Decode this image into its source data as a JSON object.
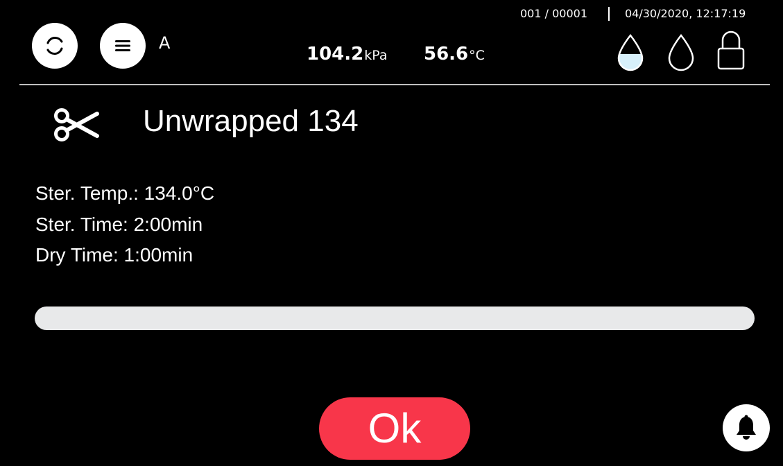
{
  "header": {
    "refresh_icon": "refresh-icon",
    "menu_icon": "menu-icon",
    "profile_letter": "A",
    "counter": "001 / 00001",
    "datetime": "04/30/2020, 12:17:19",
    "pressure": {
      "value": "104.2",
      "unit": "kPa"
    },
    "temperature": {
      "value": "56.6",
      "unit": "°C"
    },
    "status_icons": [
      "water-drop-filled-icon",
      "water-drop-empty-icon",
      "lock-open-icon"
    ],
    "water_fill_color": "#d7f0fa"
  },
  "program": {
    "icon": "scissors-icon",
    "name": "Unwrapped 134",
    "params": [
      "Ster. Temp.: 134.0°C",
      "Ster. Time: 2:00min",
      "Dry Time: 1:00min"
    ]
  },
  "progress": {
    "percent": 0,
    "track_color": "#e8e9ea"
  },
  "actions": {
    "ok_label": "Ok",
    "ok_color": "#f8364a",
    "bell_icon": "bell-icon"
  }
}
